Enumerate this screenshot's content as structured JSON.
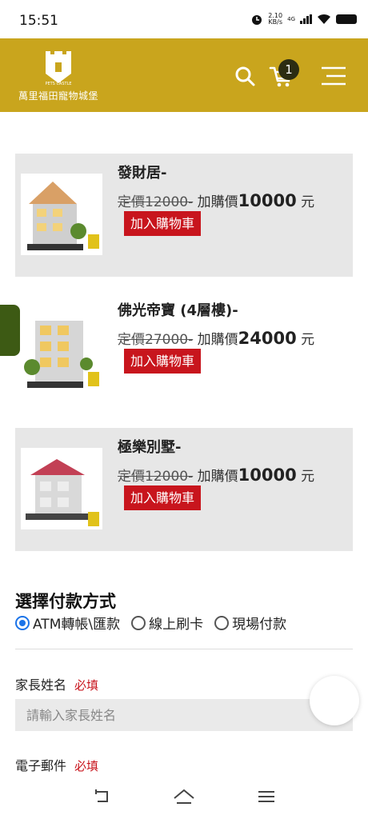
{
  "status_bar": {
    "time": "15:51",
    "net_speed": "2.10",
    "net_unit": "KB/s",
    "network_type": "4G",
    "icons": [
      "alarm-icon",
      "signal-icon",
      "wifi-icon",
      "battery-icon"
    ]
  },
  "header": {
    "logo_text": "萬里福田寵物城堡",
    "logo_small": "PETS CASTLE",
    "cart_count": "1",
    "icons": [
      "search-icon",
      "cart-icon",
      "menu-icon"
    ],
    "color": "#c9a51d"
  },
  "products": [
    {
      "name": "發財居-",
      "orig_price_label": "定價12000-",
      "deal_prefix": "加購價",
      "deal_price": "10000",
      "unit": " 元",
      "button_label": "加入購物車"
    },
    {
      "name": "佛光帝寶 (4層樓)-",
      "orig_price_label": "定價27000-",
      "deal_prefix": "加購價",
      "deal_price": "24000",
      "unit": " 元",
      "button_label": "加入購物車"
    },
    {
      "name": "極樂別墅-",
      "orig_price_label": "定價12000-",
      "deal_prefix": "加購價",
      "deal_price": "10000",
      "unit": " 元",
      "button_label": "加入購物車"
    }
  ],
  "payment": {
    "title": "選擇付款方式",
    "options": [
      {
        "label": "ATM轉帳\\匯款",
        "checked": true
      },
      {
        "label": "線上刷卡",
        "checked": false
      },
      {
        "label": "現場付款",
        "checked": false
      }
    ]
  },
  "form": {
    "parent_name": {
      "label": "家長姓名",
      "required": "必填",
      "placeholder": "請輸入家長姓名"
    },
    "email": {
      "label": "電子郵件",
      "required": "必填"
    }
  },
  "nav_bar": {
    "icons": [
      "back-icon",
      "home-icon",
      "menu-icon"
    ]
  },
  "colors": {
    "accent_red": "#c8151d",
    "radio_blue": "#1a73e8"
  }
}
